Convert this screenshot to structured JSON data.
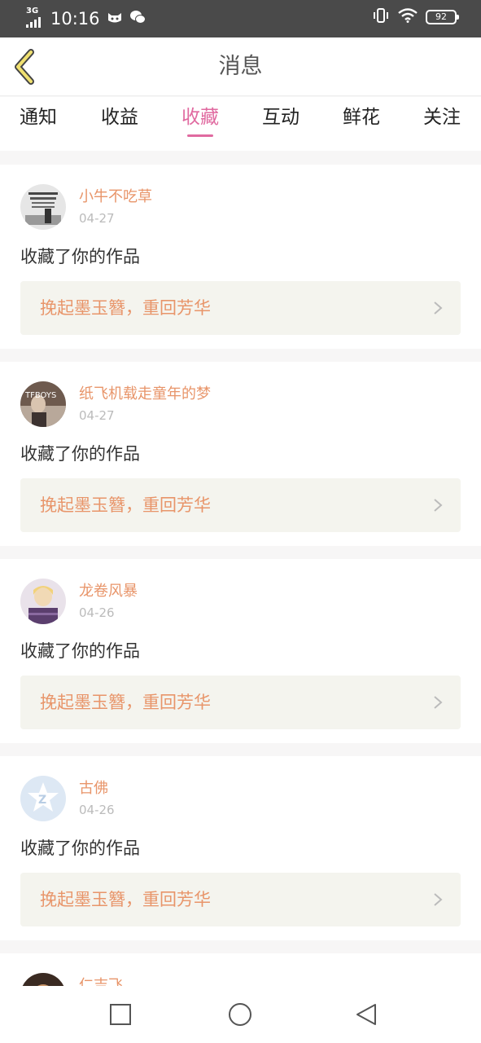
{
  "status_bar": {
    "network": "3G",
    "time": "10:16",
    "battery": "92"
  },
  "header": {
    "title": "消息"
  },
  "tabs": [
    {
      "label": "通知"
    },
    {
      "label": "收益"
    },
    {
      "label": "收藏",
      "active": true
    },
    {
      "label": "互动"
    },
    {
      "label": "鲜花"
    },
    {
      "label": "关注"
    }
  ],
  "messages": [
    {
      "name": "小牛不吃草",
      "date": "04-27",
      "action": "收藏了你的作品",
      "work": "挽起墨玉簪，重回芳华",
      "avatar": "text-poster-avatar"
    },
    {
      "name": "纸飞机载走童年的梦",
      "date": "04-27",
      "action": "收藏了你的作品",
      "work": "挽起墨玉簪，重回芳华",
      "avatar": "tfboys-photo-avatar"
    },
    {
      "name": "龙卷风暴",
      "date": "04-26",
      "action": "收藏了你的作品",
      "work": "挽起墨玉簪，重回芳华",
      "avatar": "anime-avatar"
    },
    {
      "name": "古佛",
      "date": "04-26",
      "action": "收藏了你的作品",
      "work": "挽起墨玉簪，重回芳华",
      "avatar": "default-star-avatar"
    },
    {
      "name": "仁吉飞",
      "date": "",
      "action": "",
      "work": "",
      "avatar": "photo-avatar"
    }
  ],
  "colors": {
    "accent": "#e06aa0",
    "name": "#e8956a",
    "status_bar": "#4a4a4a"
  }
}
